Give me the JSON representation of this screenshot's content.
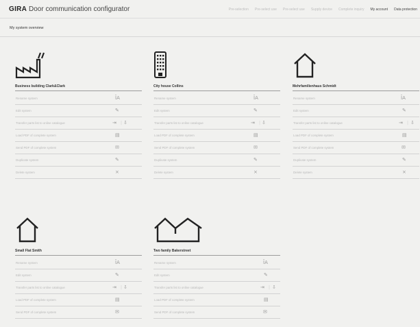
{
  "header": {
    "brand": "GIRA",
    "app_name": "Door communication configurator",
    "nav": [
      {
        "label": "Pre-selection",
        "active": false
      },
      {
        "label": "Pre-select use",
        "active": false
      },
      {
        "label": "Pre-select use",
        "active": false
      },
      {
        "label": "Supply device",
        "active": false
      },
      {
        "label": "Complete inquiry",
        "active": false
      },
      {
        "label": "My account",
        "active": true
      },
      {
        "label": "Data protection",
        "active": true
      }
    ]
  },
  "page": {
    "title": "My system overview"
  },
  "systems": [
    {
      "name": "Business building Clark&Clark",
      "icon": "factory-icon",
      "actions": [
        {
          "label": "Rename system",
          "icon": "rename-icon",
          "glyph": "ĪA"
        },
        {
          "label": "Edit system",
          "icon": "edit-icon",
          "glyph": "✎"
        },
        {
          "label": "Transfer parts list to online catalogue",
          "icon": "transfer-icon",
          "glyph": "⇥",
          "glyph2": "⇩"
        },
        {
          "label": "Load PDF of complete system",
          "icon": "pdf-icon",
          "glyph": "▤"
        },
        {
          "label": "Send PDF of complete system",
          "icon": "email-icon",
          "glyph": "✉"
        },
        {
          "label": "Duplicate system",
          "icon": "duplicate-icon",
          "glyph": "✎"
        },
        {
          "label": "Delete system",
          "icon": "delete-icon",
          "glyph": "×"
        }
      ]
    },
    {
      "name": "City house Collins",
      "icon": "apartment-building-icon",
      "actions": [
        {
          "label": "Rename system",
          "icon": "rename-icon",
          "glyph": "ĪA"
        },
        {
          "label": "Edit system",
          "icon": "edit-icon",
          "glyph": "✎"
        },
        {
          "label": "Transfer parts list to online catalogue",
          "icon": "transfer-icon",
          "glyph": "⇥",
          "glyph2": "⇩"
        },
        {
          "label": "Load PDF of complete system",
          "icon": "pdf-icon",
          "glyph": "▤"
        },
        {
          "label": "Send PDF of complete system",
          "icon": "email-icon",
          "glyph": "✉"
        },
        {
          "label": "Duplicate system",
          "icon": "duplicate-icon",
          "glyph": "✎"
        },
        {
          "label": "Delete system",
          "icon": "delete-icon",
          "glyph": "×"
        }
      ]
    },
    {
      "name": "Mehrfamilienhaus Schmidt",
      "icon": "house-icon",
      "actions": [
        {
          "label": "Rename system",
          "icon": "rename-icon",
          "glyph": "ĪA"
        },
        {
          "label": "Edit system",
          "icon": "edit-icon",
          "glyph": "✎"
        },
        {
          "label": "Transfer parts list to online catalogue",
          "icon": "transfer-icon",
          "glyph": "⇥",
          "glyph2": "⇩"
        },
        {
          "label": "Load PDF of complete system",
          "icon": "pdf-icon",
          "glyph": "▤"
        },
        {
          "label": "Send PDF of complete system",
          "icon": "email-icon",
          "glyph": "✉"
        },
        {
          "label": "Duplicate system",
          "icon": "duplicate-icon",
          "glyph": "✎"
        },
        {
          "label": "Delete system",
          "icon": "delete-icon",
          "glyph": "×"
        }
      ]
    },
    {
      "name": "Small Flat Smith",
      "icon": "house-icon",
      "actions": [
        {
          "label": "Rename system",
          "icon": "rename-icon",
          "glyph": "ĪA"
        },
        {
          "label": "Edit system",
          "icon": "edit-icon",
          "glyph": "✎"
        },
        {
          "label": "Transfer parts list to online catalogue",
          "icon": "transfer-icon",
          "glyph": "⇥",
          "glyph2": "⇩"
        },
        {
          "label": "Load PDF of complete system",
          "icon": "pdf-icon",
          "glyph": "▤"
        },
        {
          "label": "Send PDF of complete system",
          "icon": "email-icon",
          "glyph": "✉"
        }
      ]
    },
    {
      "name": "Two family Bakerstreet",
      "icon": "two-family-house-icon",
      "actions": [
        {
          "label": "Rename system",
          "icon": "rename-icon",
          "glyph": "ĪA"
        },
        {
          "label": "Edit system",
          "icon": "edit-icon",
          "glyph": "✎"
        },
        {
          "label": "Transfer parts list to online catalogue",
          "icon": "transfer-icon",
          "glyph": "⇥",
          "glyph2": "⇩"
        },
        {
          "label": "Load PDF of complete system",
          "icon": "pdf-icon",
          "glyph": "▤"
        },
        {
          "label": "Send PDF of complete system",
          "icon": "email-icon",
          "glyph": "✉"
        }
      ]
    }
  ]
}
